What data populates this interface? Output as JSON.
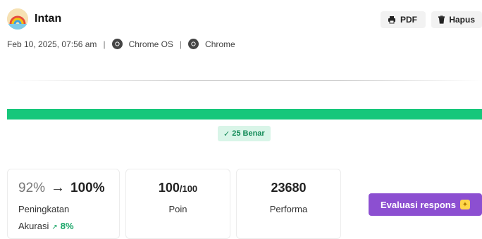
{
  "header": {
    "name": "Intan",
    "pdf_label": "PDF",
    "delete_label": "Hapus"
  },
  "meta": {
    "date": "Feb 10, 2025, 07:56 am",
    "separator": "|",
    "os": "Chrome OS",
    "browser": "Chrome"
  },
  "result": {
    "correct_badge": "25 Benar",
    "progress_fraction": 1.0
  },
  "stats": {
    "accuracy_old": "92%",
    "accuracy_new": "100%",
    "accuracy_label": "Peningkatan",
    "accuracy_sub_label": "Akurasi",
    "accuracy_delta": "8%",
    "points_value": "100",
    "points_denominator": "/100",
    "points_label": "Poin",
    "performance_value": "23680",
    "performance_label": "Performa"
  },
  "actions": {
    "evaluate_label": "Evaluasi respons"
  },
  "colors": {
    "progress": "#17c77b",
    "evaluate_button": "#8c4fd1",
    "delta": "#17a566"
  },
  "icons": {
    "avatar": "rainbow-avatar-icon",
    "pdf": "printer-icon",
    "delete": "trash-icon",
    "os": "chrome-icon",
    "browser": "chrome-icon",
    "badge": "check-icon",
    "evaluate": "sparkle-icon"
  }
}
